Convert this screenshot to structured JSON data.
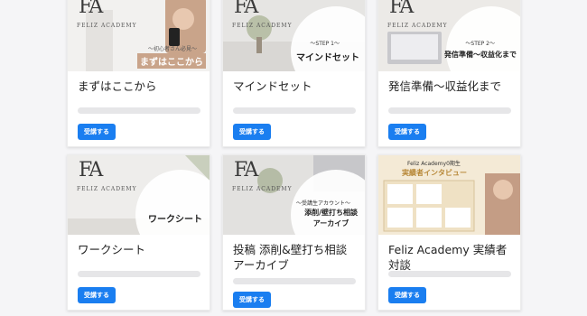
{
  "brand": {
    "logo": "FA",
    "name": "FELIZ ACADEMY"
  },
  "courses": [
    {
      "title": "まずはここから",
      "thumb_small": "〜初心者さん必見〜",
      "thumb_big": "まずはここから",
      "button": "受講する"
    },
    {
      "title": "マインドセット",
      "thumb_small": "〜STEP 1〜",
      "thumb_big": "マインドセット",
      "button": "受講する"
    },
    {
      "title": "発信準備〜収益化まで",
      "thumb_small": "〜STEP 2〜",
      "thumb_big": "発信準備〜収益化まで",
      "button": "受講する"
    },
    {
      "title": "ワークシート",
      "thumb_small": "",
      "thumb_big": "ワークシート",
      "button": "受講する"
    },
    {
      "title": "投稿 添削&壁打ち相談 アーカイブ",
      "thumb_small": "〜受講生アカウント〜",
      "thumb_big": "添削/壁打ち相談\nアーカイブ",
      "button": "受講する"
    },
    {
      "title": "Feliz Academy 実績者対談",
      "thumb_small": "Feliz Academy0期生",
      "thumb_big": "実績者インタビュー",
      "button": "受講する"
    }
  ]
}
